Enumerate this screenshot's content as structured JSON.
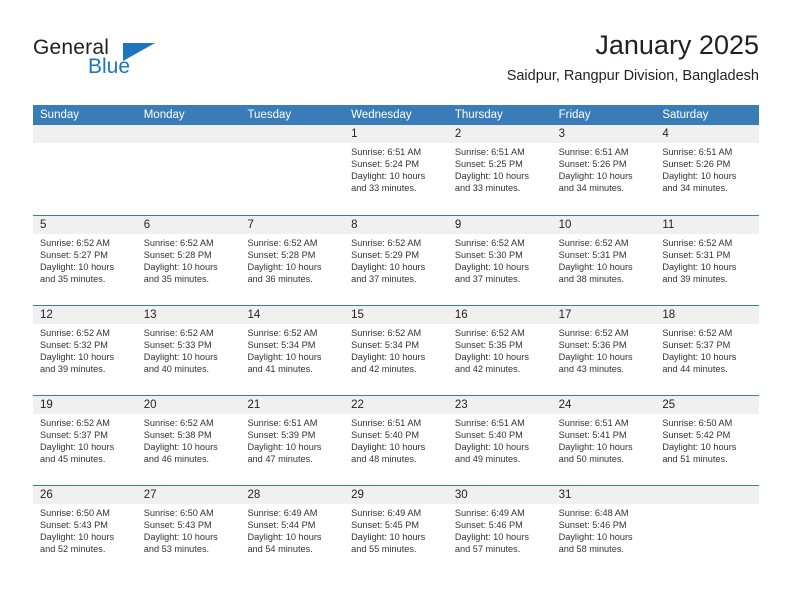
{
  "brand": {
    "name_dark": "General",
    "name_blue": "Blue",
    "accent_color": "#1d75bd"
  },
  "header": {
    "title": "January 2025",
    "subtitle": "Saidpur, Rangpur Division, Bangladesh"
  },
  "theme": {
    "header_band": "#3a7cb8",
    "day_band": "#f0f0f0",
    "text": "#231f20"
  },
  "weekday_headers": [
    "Sunday",
    "Monday",
    "Tuesday",
    "Wednesday",
    "Thursday",
    "Friday",
    "Saturday"
  ],
  "weeks": [
    [
      {
        "day": "",
        "empty": true
      },
      {
        "day": "",
        "empty": true
      },
      {
        "day": "",
        "empty": true
      },
      {
        "day": "1",
        "sunrise": "Sunrise: 6:51 AM",
        "sunset": "Sunset: 5:24 PM",
        "daylight1": "Daylight: 10 hours",
        "daylight2": "and 33 minutes."
      },
      {
        "day": "2",
        "sunrise": "Sunrise: 6:51 AM",
        "sunset": "Sunset: 5:25 PM",
        "daylight1": "Daylight: 10 hours",
        "daylight2": "and 33 minutes."
      },
      {
        "day": "3",
        "sunrise": "Sunrise: 6:51 AM",
        "sunset": "Sunset: 5:26 PM",
        "daylight1": "Daylight: 10 hours",
        "daylight2": "and 34 minutes."
      },
      {
        "day": "4",
        "sunrise": "Sunrise: 6:51 AM",
        "sunset": "Sunset: 5:26 PM",
        "daylight1": "Daylight: 10 hours",
        "daylight2": "and 34 minutes."
      }
    ],
    [
      {
        "day": "5",
        "sunrise": "Sunrise: 6:52 AM",
        "sunset": "Sunset: 5:27 PM",
        "daylight1": "Daylight: 10 hours",
        "daylight2": "and 35 minutes."
      },
      {
        "day": "6",
        "sunrise": "Sunrise: 6:52 AM",
        "sunset": "Sunset: 5:28 PM",
        "daylight1": "Daylight: 10 hours",
        "daylight2": "and 35 minutes."
      },
      {
        "day": "7",
        "sunrise": "Sunrise: 6:52 AM",
        "sunset": "Sunset: 5:28 PM",
        "daylight1": "Daylight: 10 hours",
        "daylight2": "and 36 minutes."
      },
      {
        "day": "8",
        "sunrise": "Sunrise: 6:52 AM",
        "sunset": "Sunset: 5:29 PM",
        "daylight1": "Daylight: 10 hours",
        "daylight2": "and 37 minutes."
      },
      {
        "day": "9",
        "sunrise": "Sunrise: 6:52 AM",
        "sunset": "Sunset: 5:30 PM",
        "daylight1": "Daylight: 10 hours",
        "daylight2": "and 37 minutes."
      },
      {
        "day": "10",
        "sunrise": "Sunrise: 6:52 AM",
        "sunset": "Sunset: 5:31 PM",
        "daylight1": "Daylight: 10 hours",
        "daylight2": "and 38 minutes."
      },
      {
        "day": "11",
        "sunrise": "Sunrise: 6:52 AM",
        "sunset": "Sunset: 5:31 PM",
        "daylight1": "Daylight: 10 hours",
        "daylight2": "and 39 minutes."
      }
    ],
    [
      {
        "day": "12",
        "sunrise": "Sunrise: 6:52 AM",
        "sunset": "Sunset: 5:32 PM",
        "daylight1": "Daylight: 10 hours",
        "daylight2": "and 39 minutes."
      },
      {
        "day": "13",
        "sunrise": "Sunrise: 6:52 AM",
        "sunset": "Sunset: 5:33 PM",
        "daylight1": "Daylight: 10 hours",
        "daylight2": "and 40 minutes."
      },
      {
        "day": "14",
        "sunrise": "Sunrise: 6:52 AM",
        "sunset": "Sunset: 5:34 PM",
        "daylight1": "Daylight: 10 hours",
        "daylight2": "and 41 minutes."
      },
      {
        "day": "15",
        "sunrise": "Sunrise: 6:52 AM",
        "sunset": "Sunset: 5:34 PM",
        "daylight1": "Daylight: 10 hours",
        "daylight2": "and 42 minutes."
      },
      {
        "day": "16",
        "sunrise": "Sunrise: 6:52 AM",
        "sunset": "Sunset: 5:35 PM",
        "daylight1": "Daylight: 10 hours",
        "daylight2": "and 42 minutes."
      },
      {
        "day": "17",
        "sunrise": "Sunrise: 6:52 AM",
        "sunset": "Sunset: 5:36 PM",
        "daylight1": "Daylight: 10 hours",
        "daylight2": "and 43 minutes."
      },
      {
        "day": "18",
        "sunrise": "Sunrise: 6:52 AM",
        "sunset": "Sunset: 5:37 PM",
        "daylight1": "Daylight: 10 hours",
        "daylight2": "and 44 minutes."
      }
    ],
    [
      {
        "day": "19",
        "sunrise": "Sunrise: 6:52 AM",
        "sunset": "Sunset: 5:37 PM",
        "daylight1": "Daylight: 10 hours",
        "daylight2": "and 45 minutes."
      },
      {
        "day": "20",
        "sunrise": "Sunrise: 6:52 AM",
        "sunset": "Sunset: 5:38 PM",
        "daylight1": "Daylight: 10 hours",
        "daylight2": "and 46 minutes."
      },
      {
        "day": "21",
        "sunrise": "Sunrise: 6:51 AM",
        "sunset": "Sunset: 5:39 PM",
        "daylight1": "Daylight: 10 hours",
        "daylight2": "and 47 minutes."
      },
      {
        "day": "22",
        "sunrise": "Sunrise: 6:51 AM",
        "sunset": "Sunset: 5:40 PM",
        "daylight1": "Daylight: 10 hours",
        "daylight2": "and 48 minutes."
      },
      {
        "day": "23",
        "sunrise": "Sunrise: 6:51 AM",
        "sunset": "Sunset: 5:40 PM",
        "daylight1": "Daylight: 10 hours",
        "daylight2": "and 49 minutes."
      },
      {
        "day": "24",
        "sunrise": "Sunrise: 6:51 AM",
        "sunset": "Sunset: 5:41 PM",
        "daylight1": "Daylight: 10 hours",
        "daylight2": "and 50 minutes."
      },
      {
        "day": "25",
        "sunrise": "Sunrise: 6:50 AM",
        "sunset": "Sunset: 5:42 PM",
        "daylight1": "Daylight: 10 hours",
        "daylight2": "and 51 minutes."
      }
    ],
    [
      {
        "day": "26",
        "sunrise": "Sunrise: 6:50 AM",
        "sunset": "Sunset: 5:43 PM",
        "daylight1": "Daylight: 10 hours",
        "daylight2": "and 52 minutes."
      },
      {
        "day": "27",
        "sunrise": "Sunrise: 6:50 AM",
        "sunset": "Sunset: 5:43 PM",
        "daylight1": "Daylight: 10 hours",
        "daylight2": "and 53 minutes."
      },
      {
        "day": "28",
        "sunrise": "Sunrise: 6:49 AM",
        "sunset": "Sunset: 5:44 PM",
        "daylight1": "Daylight: 10 hours",
        "daylight2": "and 54 minutes."
      },
      {
        "day": "29",
        "sunrise": "Sunrise: 6:49 AM",
        "sunset": "Sunset: 5:45 PM",
        "daylight1": "Daylight: 10 hours",
        "daylight2": "and 55 minutes."
      },
      {
        "day": "30",
        "sunrise": "Sunrise: 6:49 AM",
        "sunset": "Sunset: 5:46 PM",
        "daylight1": "Daylight: 10 hours",
        "daylight2": "and 57 minutes."
      },
      {
        "day": "31",
        "sunrise": "Sunrise: 6:48 AM",
        "sunset": "Sunset: 5:46 PM",
        "daylight1": "Daylight: 10 hours",
        "daylight2": "and 58 minutes."
      },
      {
        "day": "",
        "empty": true
      }
    ]
  ]
}
